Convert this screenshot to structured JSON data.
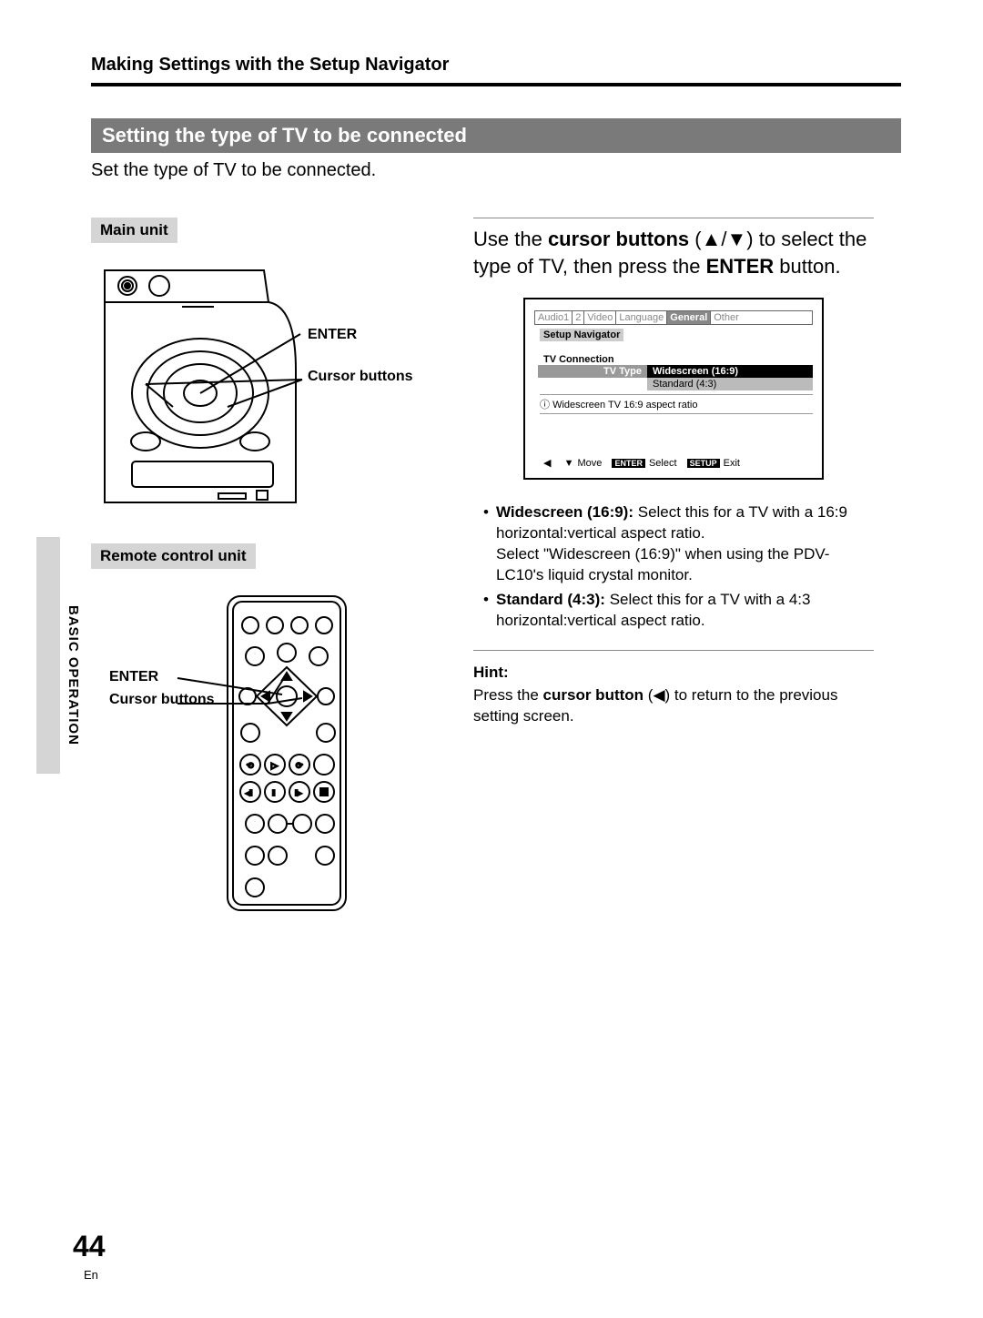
{
  "header": "Making Settings with the Setup Navigator",
  "section_title": "Setting the type of TV to be connected",
  "intro": "Set the type of TV to be connected.",
  "side_label": "BASIC OPERATION",
  "main_unit": {
    "label": "Main unit",
    "callouts": {
      "enter": "ENTER",
      "cursor": "Cursor buttons"
    }
  },
  "remote": {
    "label": "Remote control unit",
    "callouts": {
      "enter": "ENTER",
      "cursor": "Cursor buttons"
    }
  },
  "instruction": {
    "pre": "Use the ",
    "cursor_bold": "cursor buttons",
    "icons": "(▲/▼)",
    "mid": " to select the type of TV, then press the ",
    "enter_bold": "ENTER",
    "post": " button."
  },
  "osd": {
    "tabs": [
      "Audio1",
      "2",
      "Video",
      "Language",
      "General",
      "Other"
    ],
    "active_tab_index": 4,
    "setup_nav": "Setup Navigator",
    "tv_connection": "TV Connection",
    "tv_type_label": "TV Type",
    "options": [
      "Widescreen (16:9)",
      "Standard (4:3)"
    ],
    "info": "Widescreen TV 16:9 aspect ratio",
    "footer": {
      "move": "Move",
      "enter_badge": "ENTER",
      "select": "Select",
      "setup_badge": "SETUP",
      "exit": "Exit"
    }
  },
  "bullets": [
    {
      "title": "Widescreen (16:9):",
      "body": " Select this for a TV with a 16:9 horizontal:vertical aspect ratio.",
      "extra": "Select \"Widescreen (16:9)\" when using the PDV-LC10's liquid crystal monitor."
    },
    {
      "title": "Standard (4:3):",
      "body": " Select this for a TV with a 4:3 horizontal:vertical aspect ratio.",
      "extra": ""
    }
  ],
  "hint": {
    "label": "Hint:",
    "pre": "Press the ",
    "bold": "cursor button",
    "icon": "(◀)",
    "post": " to return to the previous setting screen."
  },
  "page_number": "44",
  "language": "En"
}
